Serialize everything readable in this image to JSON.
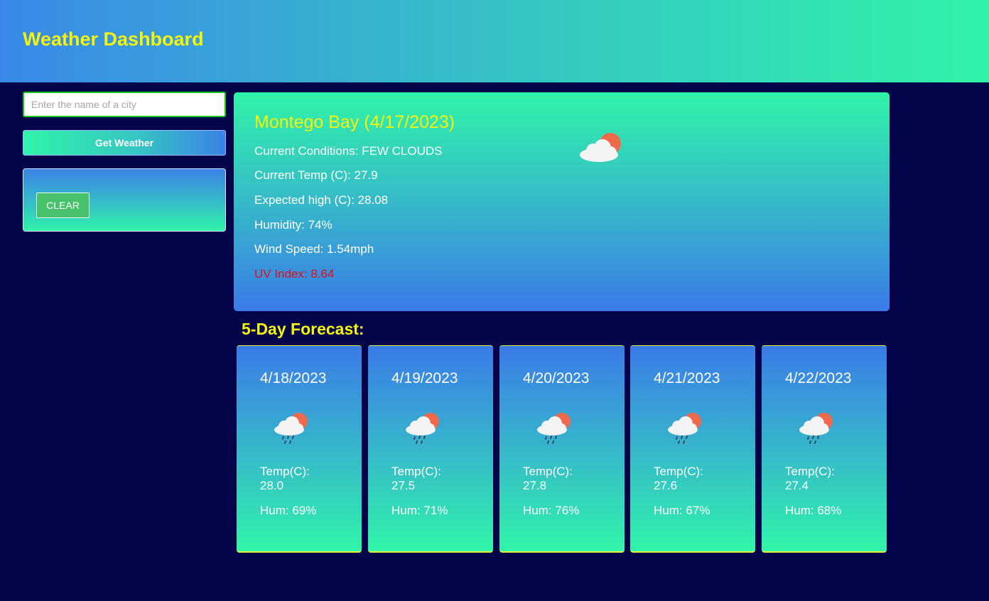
{
  "header": {
    "title": "Weather Dashboard"
  },
  "search": {
    "placeholder": "Enter the name of a city",
    "value": "",
    "button_label": "Get Weather"
  },
  "history": {
    "clear_label": "CLEAR"
  },
  "current": {
    "title": "Montego Bay (4/17/2023)",
    "conditions": "Current Conditions: FEW CLOUDS",
    "temp": "Current Temp (C): 27.9",
    "high": "Expected high (C): 28.08",
    "humidity": "Humidity: 74%",
    "wind": "Wind Speed: 1.54mph",
    "uv": "UV Index: 8.64",
    "icon": "few-clouds-icon"
  },
  "forecast": {
    "title": "5-Day Forecast:",
    "days": [
      {
        "date": "4/18/2023",
        "temp_label": "Temp(C):",
        "temp": "28.0",
        "hum": "Hum: 69%",
        "icon": "rain-clouds-icon"
      },
      {
        "date": "4/19/2023",
        "temp_label": "Temp(C):",
        "temp": "27.5",
        "hum": "Hum: 71%",
        "icon": "rain-clouds-icon"
      },
      {
        "date": "4/20/2023",
        "temp_label": "Temp(C):",
        "temp": "27.8",
        "hum": "Hum: 76%",
        "icon": "rain-clouds-icon"
      },
      {
        "date": "4/21/2023",
        "temp_label": "Temp(C):",
        "temp": "27.6",
        "hum": "Hum: 67%",
        "icon": "rain-clouds-icon"
      },
      {
        "date": "4/22/2023",
        "temp_label": "Temp(C):",
        "temp": "27.4",
        "hum": "Hum: 68%",
        "icon": "rain-clouds-icon"
      }
    ]
  },
  "colors": {
    "background": "#03044a",
    "title_yellow": "#f4f50a",
    "uv_red": "#e0101a",
    "clear_green": "#47c16a",
    "input_border": "#18c41e"
  }
}
